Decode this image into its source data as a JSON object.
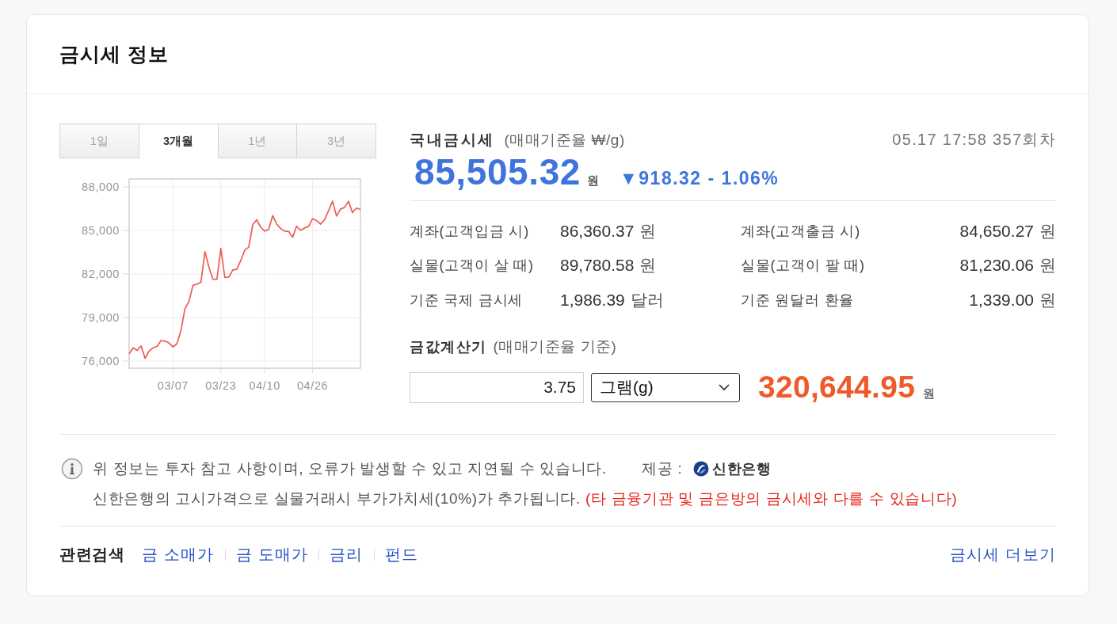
{
  "header": {
    "title": "금시세 정보"
  },
  "chart_panel": {
    "tabs": [
      {
        "label": "1일",
        "selected": false
      },
      {
        "label": "3개월",
        "selected": true
      },
      {
        "label": "1년",
        "selected": false
      },
      {
        "label": "3년",
        "selected": false
      }
    ],
    "chart_data": {
      "type": "line",
      "grid": true,
      "categories": [
        null,
        null,
        null,
        null,
        null,
        null,
        null,
        null,
        null,
        null,
        null,
        "03/07",
        null,
        null,
        null,
        null,
        null,
        null,
        null,
        null,
        null,
        null,
        null,
        "03/23",
        null,
        null,
        null,
        null,
        null,
        null,
        null,
        null,
        null,
        null,
        "04/10",
        null,
        null,
        null,
        null,
        null,
        null,
        null,
        null,
        null,
        null,
        null,
        "04/26",
        null,
        null,
        null,
        null,
        null,
        null,
        null,
        null,
        null,
        null,
        null,
        null
      ],
      "series": [
        {
          "color": "#ee5a54",
          "values": [
            76490,
            76910,
            76730,
            77040,
            76180,
            76680,
            76910,
            77000,
            77410,
            77370,
            77240,
            76970,
            77190,
            78100,
            79600,
            80110,
            81210,
            81300,
            81430,
            83530,
            82480,
            81640,
            81640,
            83760,
            81750,
            81790,
            82280,
            82320,
            82940,
            83640,
            83850,
            85410,
            85740,
            85220,
            84950,
            85080,
            86030,
            85440,
            85130,
            84950,
            84930,
            84530,
            85300,
            85010,
            85170,
            85280,
            85810,
            85680,
            85440,
            85740,
            86360,
            87010,
            85990,
            86470,
            86590,
            87010,
            86230,
            86540,
            86450
          ]
        }
      ],
      "ylim": [
        75500,
        88550
      ],
      "yticks": [
        {
          "value": 88000,
          "label": "88,000"
        },
        {
          "value": 85000,
          "label": "85,000"
        },
        {
          "value": 82000,
          "label": "82,000"
        },
        {
          "value": 79000,
          "label": "79,000"
        },
        {
          "value": 76000,
          "label": "76,000"
        }
      ]
    }
  },
  "price": {
    "title": "국내금시세",
    "basis": "(매매기준율 ₩/g)",
    "timestamp": "05.17 17:58 357회차",
    "value": "85,505.32",
    "unit": "원",
    "change": "▼918.32 - 1.06%"
  },
  "rates": [
    {
      "label": "계좌(고객입금 시)",
      "value": "86,360.37",
      "unit": "원"
    },
    {
      "label": "계좌(고객출금 시)",
      "value": "84,650.27",
      "unit": "원"
    },
    {
      "label": "실물(고객이 살 때)",
      "value": "89,780.58",
      "unit": "원"
    },
    {
      "label": "실물(고객이 팔 때)",
      "value": "81,230.06",
      "unit": "원"
    },
    {
      "label": "기준 국제 금시세",
      "value": "1,986.39",
      "unit": "달러"
    },
    {
      "label": "기준 원달러 환율",
      "value": "1,339.00",
      "unit": "원"
    }
  ],
  "calculator": {
    "title": "금값계산기",
    "basis": "(매매기준율 기준)",
    "amount": "3.75",
    "unit_option": "그램(g)",
    "result": "320,644.95",
    "result_unit": "원"
  },
  "notice": {
    "text": "위 정보는 투자 참고 사항이며, 오류가 발생할 수 있고 지연될 수 있습니다.",
    "provider_label": "제공 :",
    "provider": "신한은행",
    "note": "신한은행의 고시가격으로 실물거래시 부가가치세(10%)가 추가됩니다.",
    "warning": "(타 금융기관 및 금은방의 금시세와 다를 수 있습니다)"
  },
  "related": {
    "label": "관련검색",
    "links": [
      "금 소매가",
      "금 도매가",
      "금리",
      "펀드"
    ],
    "more": "금시세 더보기"
  }
}
